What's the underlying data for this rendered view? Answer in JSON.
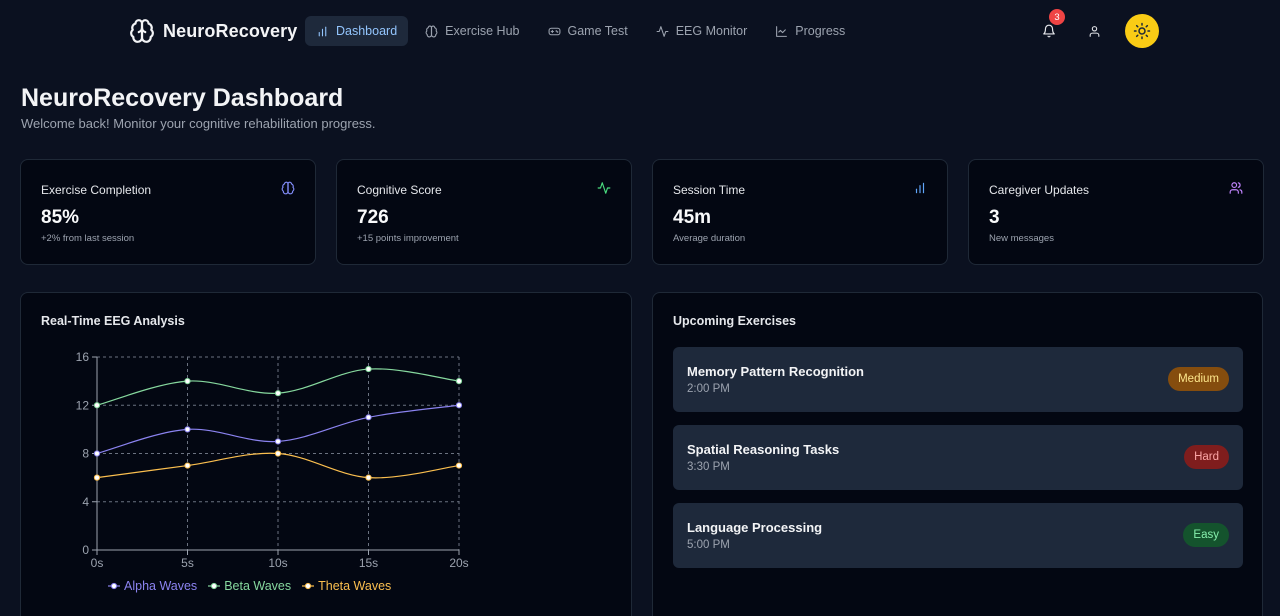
{
  "nav": {
    "brand": "NeuroRecovery",
    "items": [
      {
        "label": "Dashboard",
        "icon": "bar-chart-icon",
        "active": true
      },
      {
        "label": "Exercise Hub",
        "icon": "brain-icon",
        "active": false
      },
      {
        "label": "Game Test",
        "icon": "gamepad-icon",
        "active": false
      },
      {
        "label": "EEG Monitor",
        "icon": "activity-icon",
        "active": false
      },
      {
        "label": "Progress",
        "icon": "line-chart-icon",
        "active": false
      }
    ],
    "notifications_count": "3"
  },
  "header": {
    "title": "NeuroRecovery Dashboard",
    "subtitle": "Welcome back! Monitor your cognitive rehabilitation progress."
  },
  "stats": [
    {
      "label": "Exercise Completion",
      "value": "85%",
      "note": "+2% from last session",
      "icon": "brain-icon",
      "icon_color": "#818cf8"
    },
    {
      "label": "Cognitive Score",
      "value": "726",
      "note": "+15 points improvement",
      "icon": "activity-icon",
      "icon_color": "#4ade80"
    },
    {
      "label": "Session Time",
      "value": "45m",
      "note": "Average duration",
      "icon": "bar-chart-icon",
      "icon_color": "#60a5fa"
    },
    {
      "label": "Caregiver Updates",
      "value": "3",
      "note": "New messages",
      "icon": "users-icon",
      "icon_color": "#c084fc"
    }
  ],
  "eeg_panel": {
    "title": "Real-Time EEG Analysis"
  },
  "chart_data": {
    "type": "line",
    "x": [
      "0s",
      "5s",
      "10s",
      "15s",
      "20s"
    ],
    "series": [
      {
        "name": "Alpha Waves",
        "values": [
          8,
          10,
          9,
          11,
          12
        ],
        "color": "#8b83f0"
      },
      {
        "name": "Beta Waves",
        "values": [
          12,
          14,
          13,
          15,
          14
        ],
        "color": "#86d89e"
      },
      {
        "name": "Theta Waves",
        "values": [
          6,
          7,
          8,
          6,
          7
        ],
        "color": "#fbbf4f"
      }
    ],
    "y_ticks": [
      0,
      4,
      8,
      12,
      16
    ],
    "ylim": [
      0,
      16
    ],
    "grid": "dashed",
    "legend": "bottom"
  },
  "upcoming": {
    "title": "Upcoming Exercises",
    "items": [
      {
        "name": "Memory Pattern Recognition",
        "time": "2:00 PM",
        "difficulty": "Medium",
        "bg": "#854d0e",
        "fg": "#fde68a"
      },
      {
        "name": "Spatial Reasoning Tasks",
        "time": "3:30 PM",
        "difficulty": "Hard",
        "bg": "#7f1d1d",
        "fg": "#fca5a5"
      },
      {
        "name": "Language Processing",
        "time": "5:00 PM",
        "difficulty": "Easy",
        "bg": "#14532d",
        "fg": "#86efac"
      }
    ]
  }
}
